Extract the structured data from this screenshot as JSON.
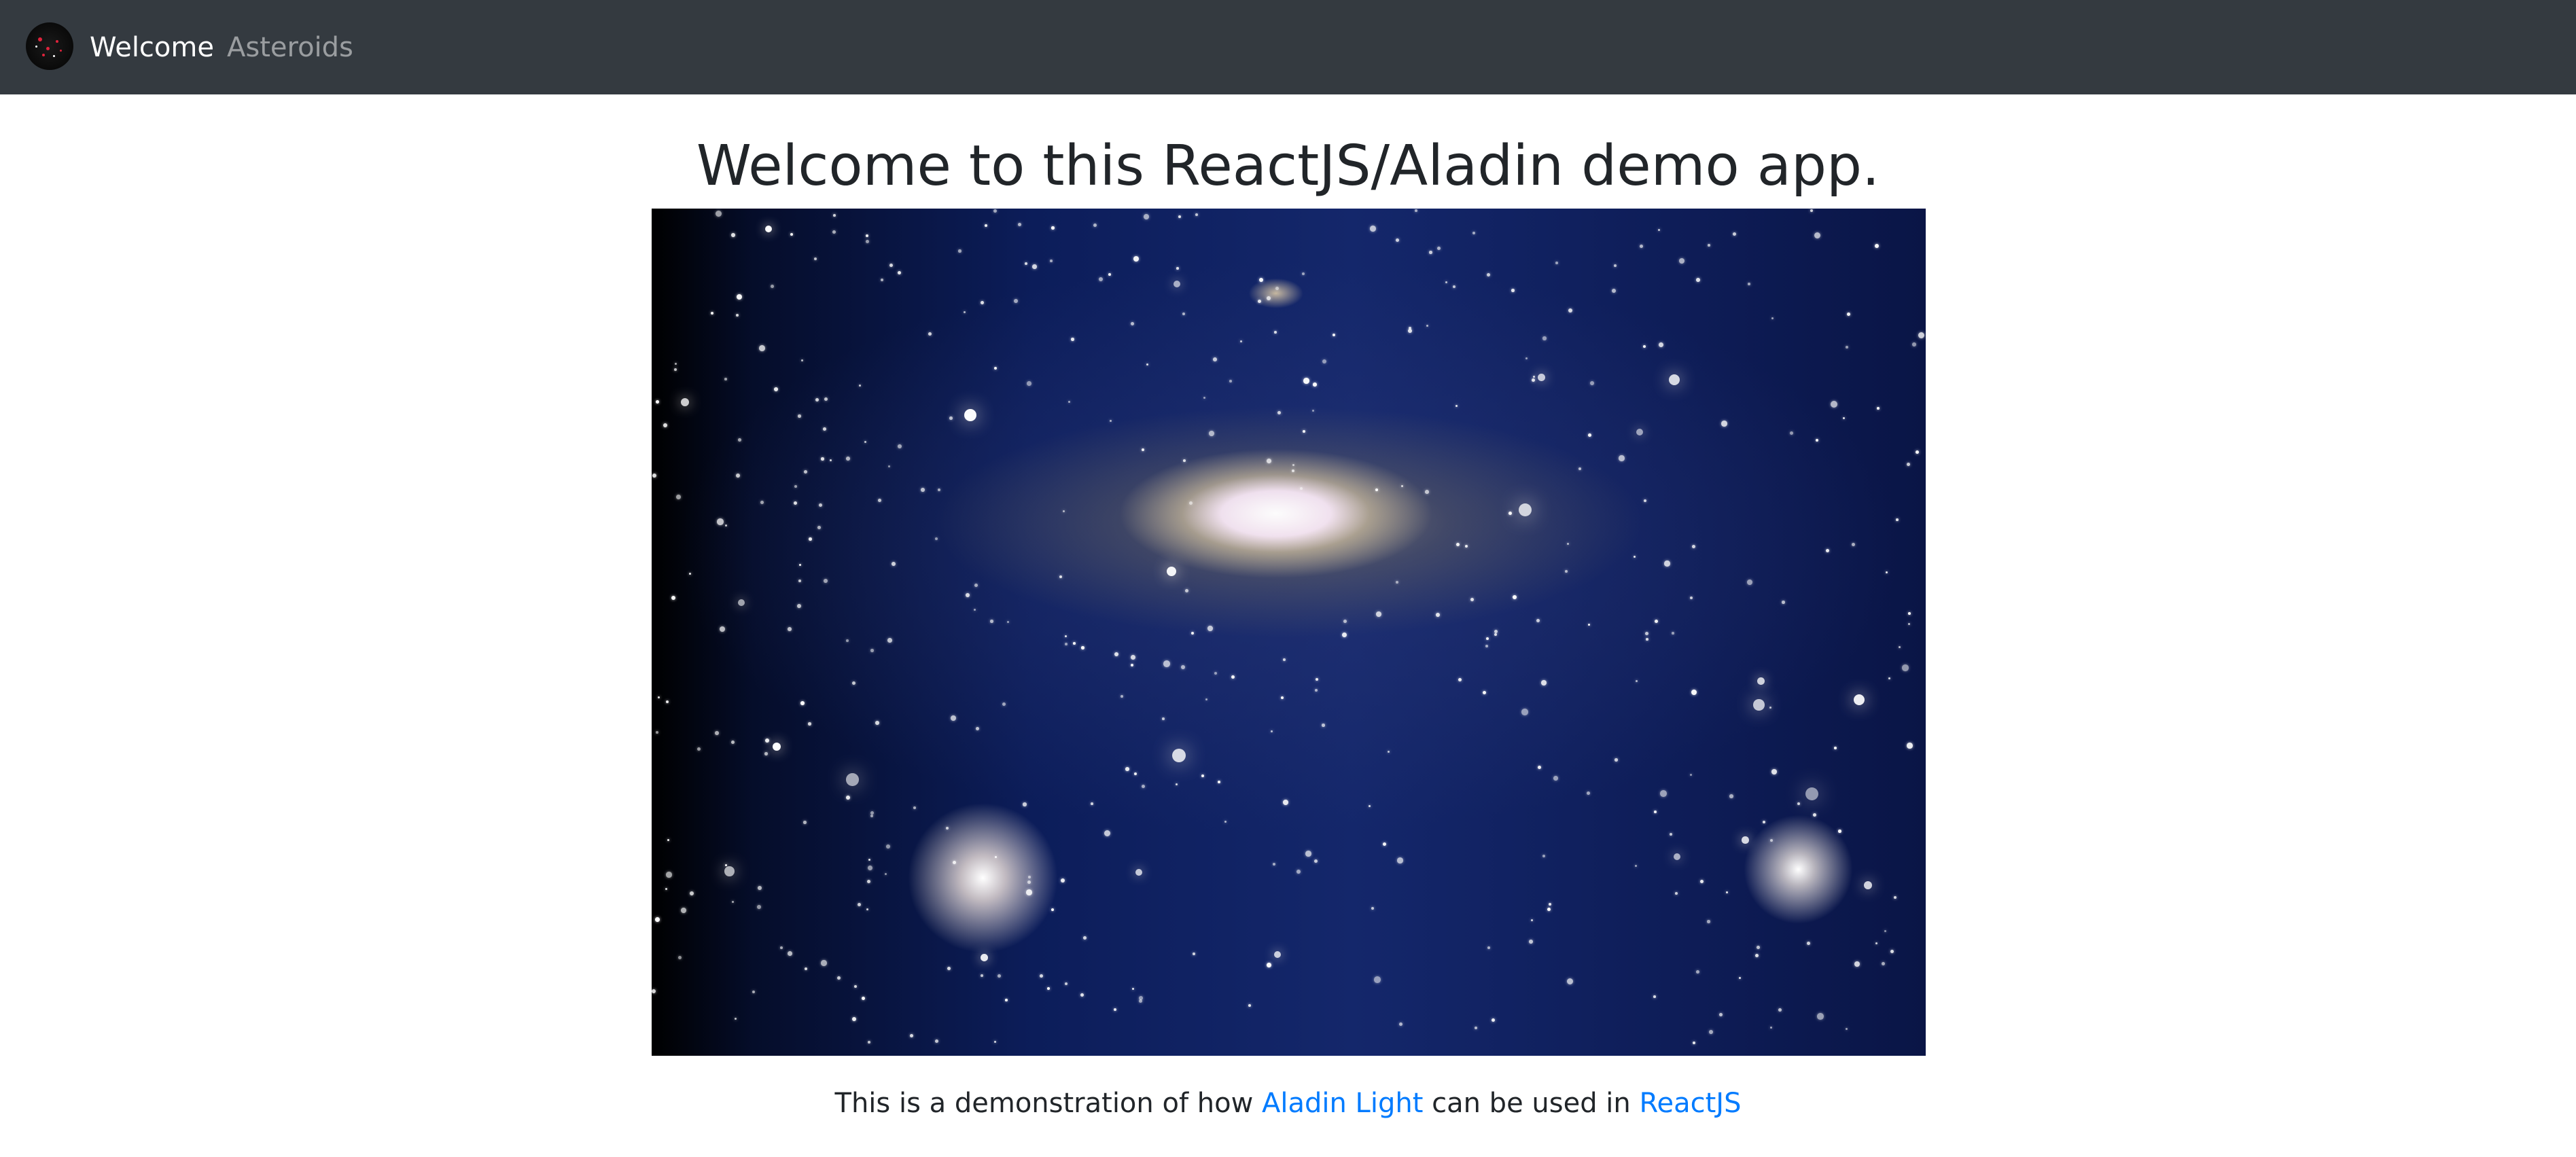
{
  "navbar": {
    "logo_icon": "asteroid-logo-icon",
    "links": [
      {
        "label": "Welcome",
        "active": true
      },
      {
        "label": "Asteroids",
        "active": false
      }
    ],
    "background": "#343a40"
  },
  "main": {
    "title": "Welcome to this ReactJS/Aladin demo app.",
    "hero_image": "galaxy-image",
    "caption": {
      "prefix": "This is a demonstration of how ",
      "link1": "Aladin Light",
      "middle": " can be used in ",
      "link2": "ReactJS"
    },
    "link_color": "#007bff",
    "text_color": "#212529"
  }
}
